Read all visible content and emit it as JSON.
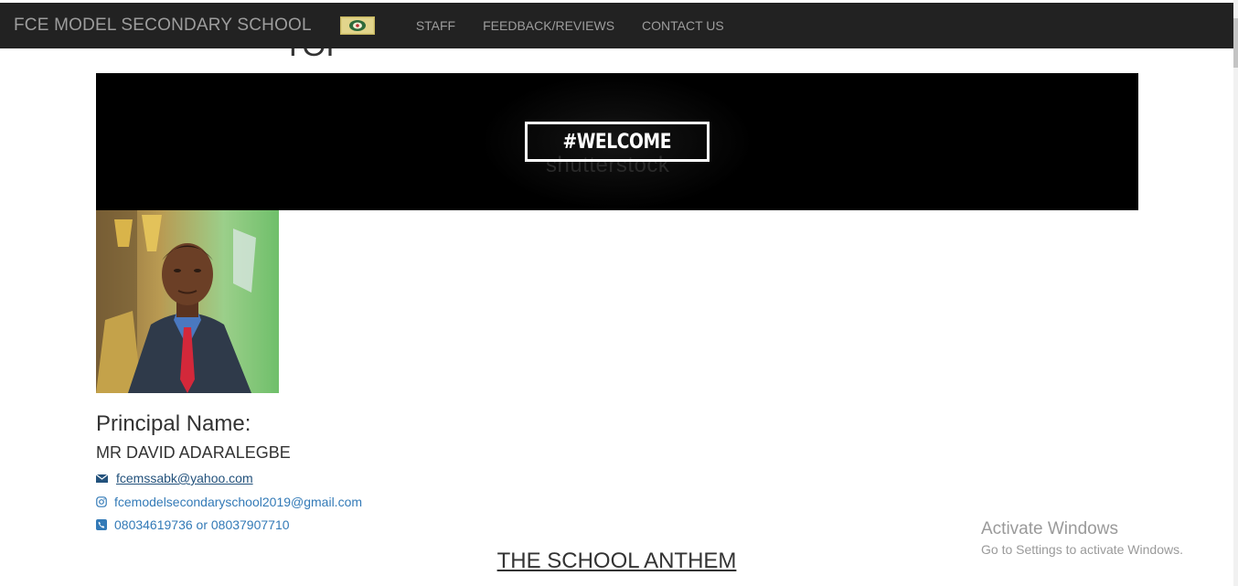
{
  "navbar": {
    "brand": "FCE MODEL SECONDARY SCHOOL",
    "links": [
      "STAFF",
      "FEEDBACK/REVIEWS",
      "CONTACT US"
    ]
  },
  "partial_heading": "TOP",
  "banner": {
    "welcome_text": "#WELCOME",
    "watermark": "shutterstock"
  },
  "principal": {
    "label": "Principal Name:",
    "name": "MR DAVID ADARALEGBE",
    "email": "fcemssabk@yahoo.com",
    "instagram": "fcemodelsecondaryschool2019@gmail.com",
    "phone": "08034619736 or 08037907710"
  },
  "anthem_heading": "THE SCHOOL ANTHEM",
  "os_overlay": {
    "title": "Activate Windows",
    "subtitle": "Go to Settings to activate Windows."
  },
  "colors": {
    "navbar_bg": "#222222",
    "nav_text": "#9d9d9d",
    "link_blue": "#337ab7",
    "banner_bg": "#000000"
  },
  "icons": [
    "envelope-icon",
    "instagram-icon",
    "phone-square-icon",
    "school-crest-icon"
  ]
}
